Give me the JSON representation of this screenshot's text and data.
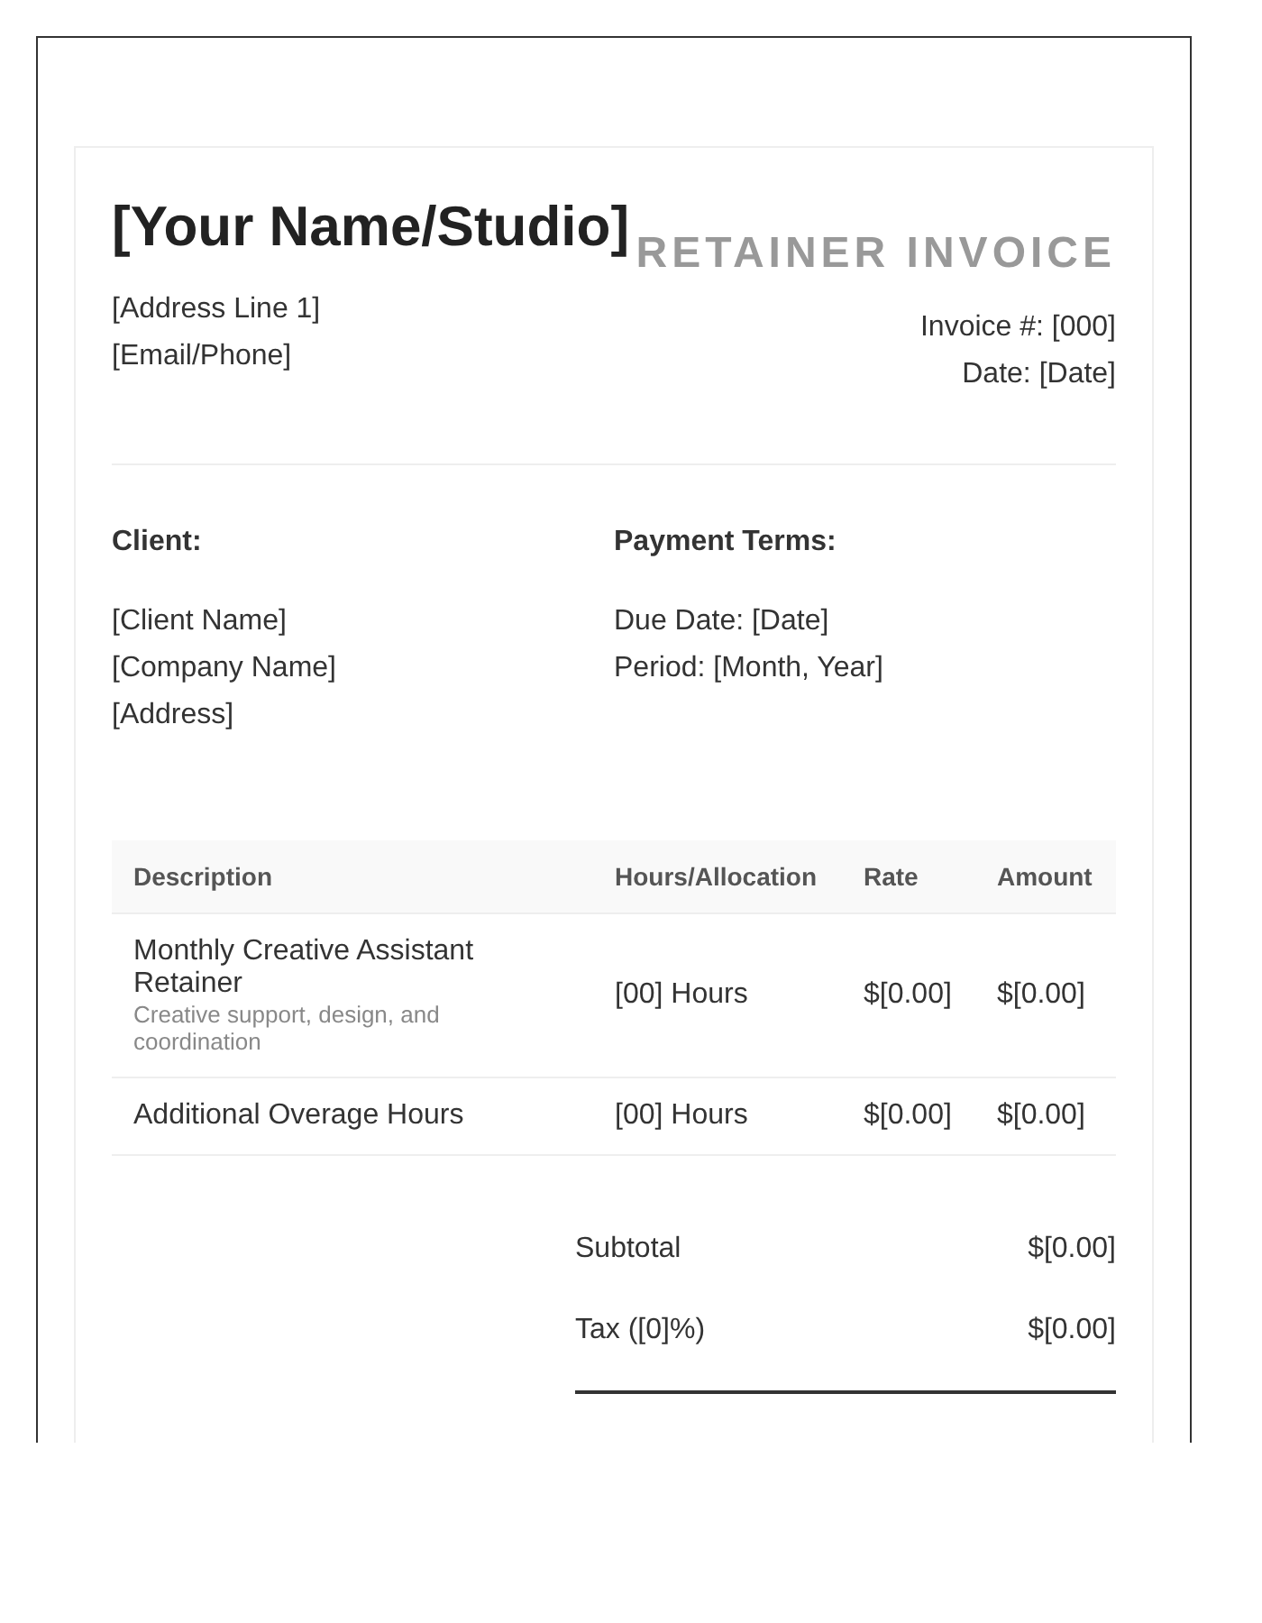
{
  "studio_name": "[Your Name/Studio]",
  "document_title": "RETAINER INVOICE",
  "sender_lines": [
    "[Address Line 1]",
    "[Email/Phone]"
  ],
  "invoice_meta": [
    "Invoice #: [000]",
    "Date: [Date]"
  ],
  "client": {
    "heading": "Client:",
    "lines": [
      "[Client Name]",
      "[Company Name]",
      "[Address]"
    ]
  },
  "payment_terms": {
    "heading": "Payment Terms:",
    "lines": [
      "Due Date: [Date]",
      "Period: [Month, Year]"
    ]
  },
  "table": {
    "columns": [
      "Description",
      "Hours/Allocation",
      "Rate",
      "Amount"
    ],
    "rows": [
      {
        "description": "Monthly Creative Assistant Retainer",
        "note": "Creative support, design, and coordination",
        "hours": "[00] Hours",
        "rate": "$[0.00]",
        "amount": "$[0.00]"
      },
      {
        "description": "Additional Overage Hours",
        "hours": "[00] Hours",
        "rate": "$[0.00]",
        "amount": "$[0.00]"
      }
    ]
  },
  "totals": [
    {
      "label": "Subtotal",
      "value": "$[0.00]"
    },
    {
      "label": "Tax ([0]%)",
      "value": "$[0.00]"
    }
  ]
}
